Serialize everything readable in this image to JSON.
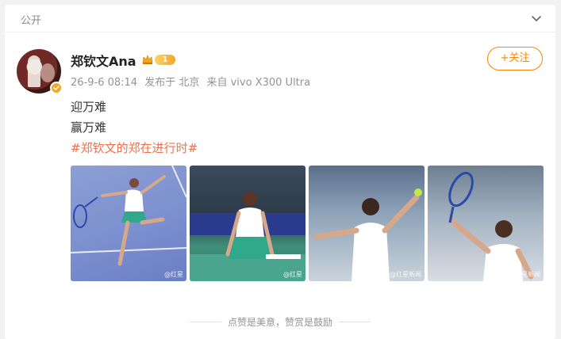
{
  "topbar": {
    "visibility": "公开"
  },
  "post": {
    "author": "郑钦文Ana",
    "vip_level": "1",
    "timestamp": "26-9-6 08:14",
    "location": "发布于 北京",
    "device": "来自 vivo X300 Ultra",
    "follow_label": "+关注",
    "lines": [
      "迎万难",
      "赢万难"
    ],
    "hashtag": "#郑钦文的郑在进行时#",
    "photos": [
      {
        "id": "p1",
        "watermark": "@红星"
      },
      {
        "id": "p2",
        "watermark": "@红星"
      },
      {
        "id": "p3",
        "watermark": "@红星新闻"
      },
      {
        "id": "p4",
        "watermark": "@红星新闻"
      }
    ]
  },
  "footer": {
    "note": "点赞是美意，赞赏是鼓励"
  },
  "colors": {
    "accent": "#ff8200",
    "hashtag": "#eb7350",
    "muted": "#939393"
  },
  "icons": [
    "chevron-down-icon",
    "verified-icon",
    "vip-crown-icon"
  ]
}
